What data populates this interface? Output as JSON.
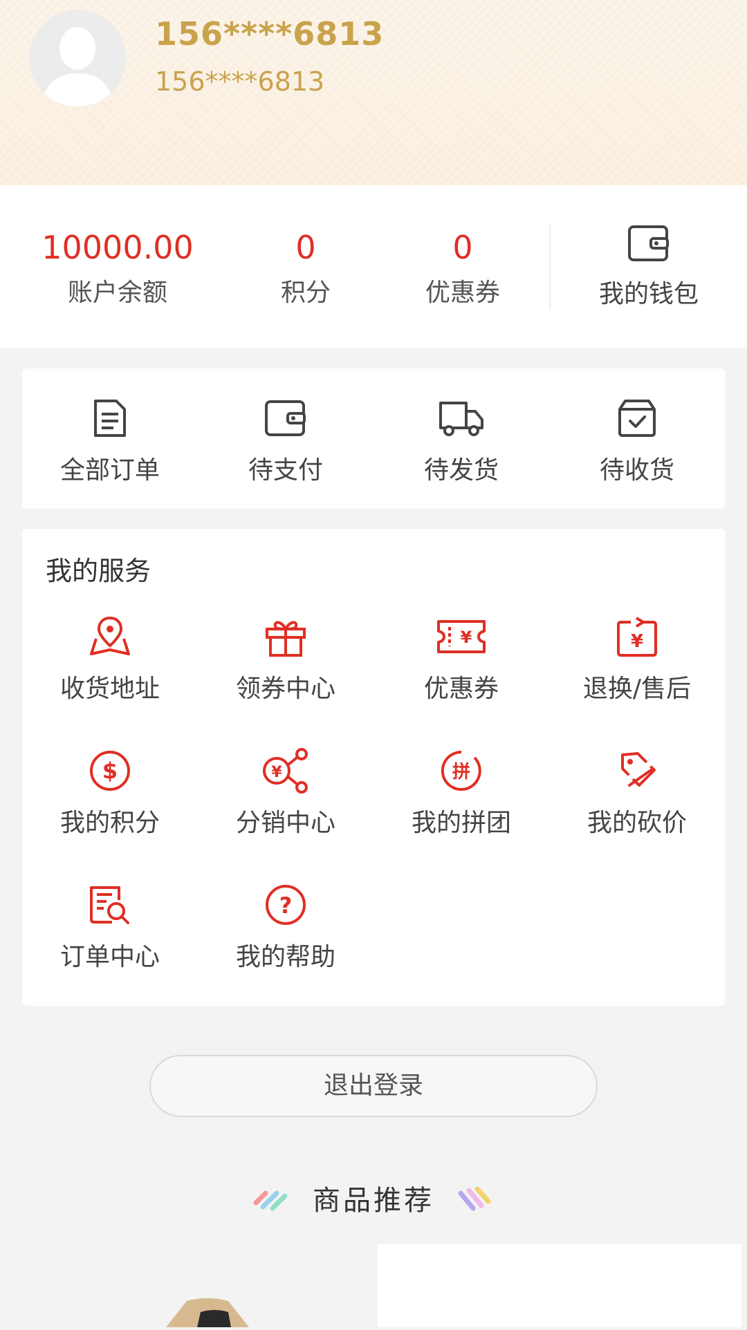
{
  "user": {
    "name": "156****6813",
    "phone": "156****6813"
  },
  "stats": {
    "balance": {
      "value": "10000.00",
      "label": "账户余额"
    },
    "points": {
      "value": "0",
      "label": "积分"
    },
    "coupons": {
      "value": "0",
      "label": "优惠券"
    },
    "wallet": {
      "label": "我的钱包",
      "icon": "wallet-icon"
    }
  },
  "orders": [
    {
      "label": "全部订单",
      "icon": "document-icon"
    },
    {
      "label": "待支付",
      "icon": "wallet-icon"
    },
    {
      "label": "待发货",
      "icon": "truck-icon"
    },
    {
      "label": "待收货",
      "icon": "box-check-icon"
    }
  ],
  "services": {
    "title": "我的服务",
    "items": [
      {
        "label": "收货地址",
        "icon": "map-pin-icon"
      },
      {
        "label": "领券中心",
        "icon": "gift-icon"
      },
      {
        "label": "优惠券",
        "icon": "ticket-icon"
      },
      {
        "label": "退换/售后",
        "icon": "refund-icon"
      },
      {
        "label": "我的积分",
        "icon": "dollar-circle-icon"
      },
      {
        "label": "分销中心",
        "icon": "share-icon"
      },
      {
        "label": "我的拼团",
        "icon": "group-buy-icon"
      },
      {
        "label": "我的砍价",
        "icon": "price-tag-icon"
      },
      {
        "label": "订单中心",
        "icon": "order-search-icon"
      },
      {
        "label": "我的帮助",
        "icon": "help-icon"
      }
    ]
  },
  "logout": {
    "label": "退出登录"
  },
  "recommend": {
    "title": "商品推荐"
  },
  "colors": {
    "accent": "#e02e24",
    "gold": "#c9a24c"
  }
}
